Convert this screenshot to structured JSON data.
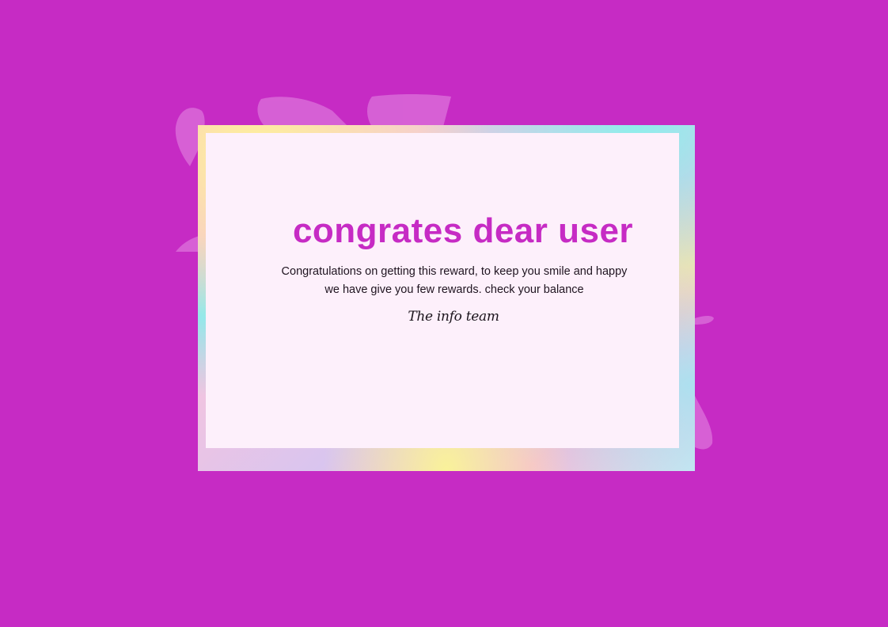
{
  "card": {
    "title": "congrates dear user",
    "message": "Congratulations on getting this reward, to keep you smile and happy we have give you few rewards. check your balance",
    "signature": "The info team"
  },
  "colors": {
    "background": "#c62bc4",
    "title": "#c62bc4",
    "card": "#fdf0fb",
    "text": "#1f1420"
  }
}
